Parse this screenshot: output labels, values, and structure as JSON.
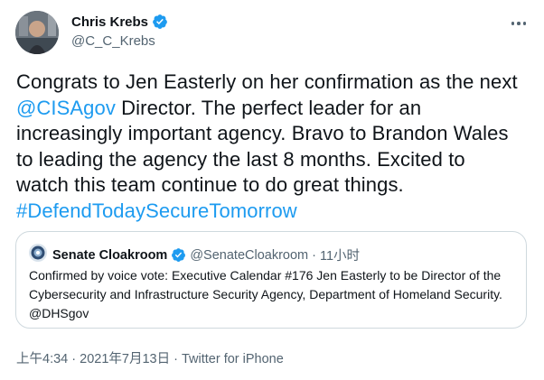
{
  "author": {
    "name": "Chris Krebs",
    "handle": "@C_C_Krebs"
  },
  "tweet": {
    "text_part1": "Congrats to Jen Easterly on her confirmation as the next ",
    "mention": "@CISAgov",
    "text_part2": " Director. The perfect leader for an increasingly important agency. Bravo to Brandon Wales to leading the agency the last 8 months. Excited to watch this team continue to do great things. ",
    "hashtag": "#DefendTodaySecureTomorrow"
  },
  "quoted": {
    "name": "Senate Cloakroom",
    "handle": "@SenateCloakroom",
    "dot": "·",
    "time": "11小时",
    "text": "Confirmed by voice vote: Executive Calendar #176 Jen Easterly to be Director of the Cybersecurity and Infrastructure Security Agency, Department of Homeland Security. @DHSgov"
  },
  "footer": {
    "time": "上午4:34",
    "sep1": " · ",
    "date": "2021年7月13日",
    "sep2": " · ",
    "client": "Twitter for iPhone"
  },
  "colors": {
    "link": "#1d9bf0",
    "verified": "#1d9bf0",
    "secondary_text": "#536471"
  },
  "icons": [
    "verified-badge-icon",
    "more-options-icon",
    "verified-badge-icon"
  ]
}
